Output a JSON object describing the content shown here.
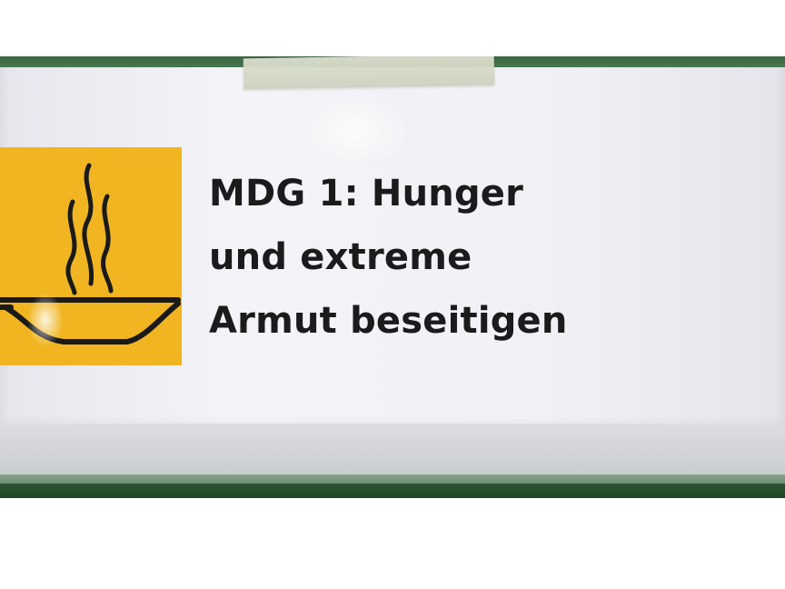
{
  "sign": {
    "icon": "steaming-bowl-icon",
    "lines": [
      "MDG 1: Hunger",
      "und extreme",
      "Armut beseitigen"
    ]
  },
  "colors": {
    "icon_background": "#f0b521",
    "icon_stroke": "#1a1a1a",
    "board_green": "#2f5a36",
    "sheet_white": "#f2f2f6",
    "text": "#1b1b1e"
  }
}
